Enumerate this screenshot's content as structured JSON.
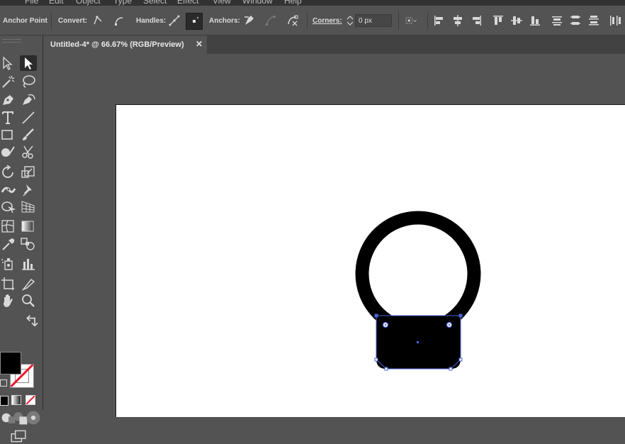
{
  "menu": {
    "items": [
      "File",
      "Edit",
      "Object",
      "Type",
      "Select",
      "Effect",
      "View",
      "Window",
      "Help"
    ]
  },
  "control_bar": {
    "tool_name": "Anchor Point",
    "convert_label": "Convert:",
    "handles_label": "Handles:",
    "anchors_label": "Anchors:",
    "corners_label": "Corners:",
    "corners_value": "0 px"
  },
  "document": {
    "tab_title": "Untitled-4* @ 66.67% (RGB/Preview)",
    "close_glyph": "✕"
  },
  "colors": {
    "ui_bg": "#535353",
    "toolbar_active": "#2b2b2b",
    "artboard": "#ffffff",
    "selection": "#4a63d8",
    "shape_fill": "#000000"
  },
  "tools": [
    "selection-tool-icon",
    "direct-selection-tool-icon",
    "magic-wand-tool-icon",
    "lasso-tool-icon",
    "pen-tool-icon",
    "curvature-tool-icon",
    "type-tool-icon",
    "line-segment-tool-icon",
    "rectangle-tool-icon",
    "paintbrush-tool-icon",
    "shaper-tool-icon",
    "scissors-tool-icon",
    "rotate-tool-icon",
    "scale-tool-icon",
    "width-tool-icon",
    "puppet-warp-tool-icon",
    "shape-builder-tool-icon",
    "perspective-grid-tool-icon",
    "mesh-tool-icon",
    "gradient-tool-icon",
    "eyedropper-tool-icon",
    "blend-tool-icon",
    "symbol-sprayer-tool-icon",
    "column-graph-tool-icon",
    "artboard-tool-icon",
    "slice-tool-icon",
    "hand-tool-icon",
    "zoom-tool-icon"
  ],
  "active_tool": "direct-selection-tool-icon"
}
